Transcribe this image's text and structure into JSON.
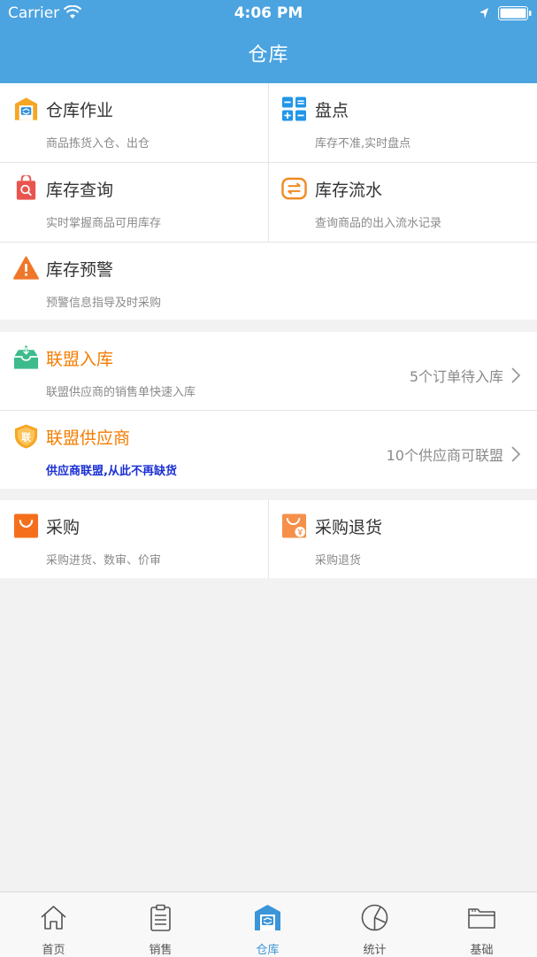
{
  "status_bar": {
    "carrier": "Carrier",
    "time": "4:06 PM"
  },
  "header": {
    "title": "仓库"
  },
  "section1": {
    "items": [
      {
        "title": "仓库作业",
        "subtitle": "商品拣货入仓、出仓",
        "icon": "warehouse-icon"
      },
      {
        "title": "盘点",
        "subtitle": "库存不准,实时盘点",
        "icon": "calculator-icon"
      },
      {
        "title": "库存查询",
        "subtitle": "实时掌握商品可用库存",
        "icon": "inventory-search-icon"
      },
      {
        "title": "库存流水",
        "subtitle": "查询商品的出入流水记录",
        "icon": "transfer-icon"
      },
      {
        "title": "库存预警",
        "subtitle": "预警信息指导及时采购",
        "icon": "warning-icon"
      }
    ]
  },
  "section2": {
    "items": [
      {
        "title": "联盟入库",
        "subtitle": "联盟供应商的销售单快速入库",
        "action": "5个订单待入库",
        "icon": "inbox-download-icon"
      },
      {
        "title": "联盟供应商",
        "subtitle": "供应商联盟,从此不再缺货",
        "action": "10个供应商可联盟",
        "icon": "alliance-badge-icon",
        "badge_text": "联"
      }
    ]
  },
  "section3": {
    "items": [
      {
        "title": "采购",
        "subtitle": "采购进货、数审、价审",
        "icon": "shopping-bag-icon"
      },
      {
        "title": "采购退货",
        "subtitle": "采购退货",
        "icon": "shopping-bag-return-icon"
      }
    ]
  },
  "tabbar": {
    "tabs": [
      {
        "label": "首页",
        "icon": "home-icon",
        "active": false
      },
      {
        "label": "销售",
        "icon": "clipboard-icon",
        "active": false
      },
      {
        "label": "仓库",
        "icon": "warehouse-icon",
        "active": true
      },
      {
        "label": "统计",
        "icon": "pie-chart-icon",
        "active": false
      },
      {
        "label": "基础",
        "icon": "folder-icon",
        "active": false
      }
    ]
  },
  "colors": {
    "header": "#4ba3e0",
    "accent_orange": "#f57c00",
    "active_tab": "#3a95d9",
    "blue_text": "#1a2fd4"
  }
}
